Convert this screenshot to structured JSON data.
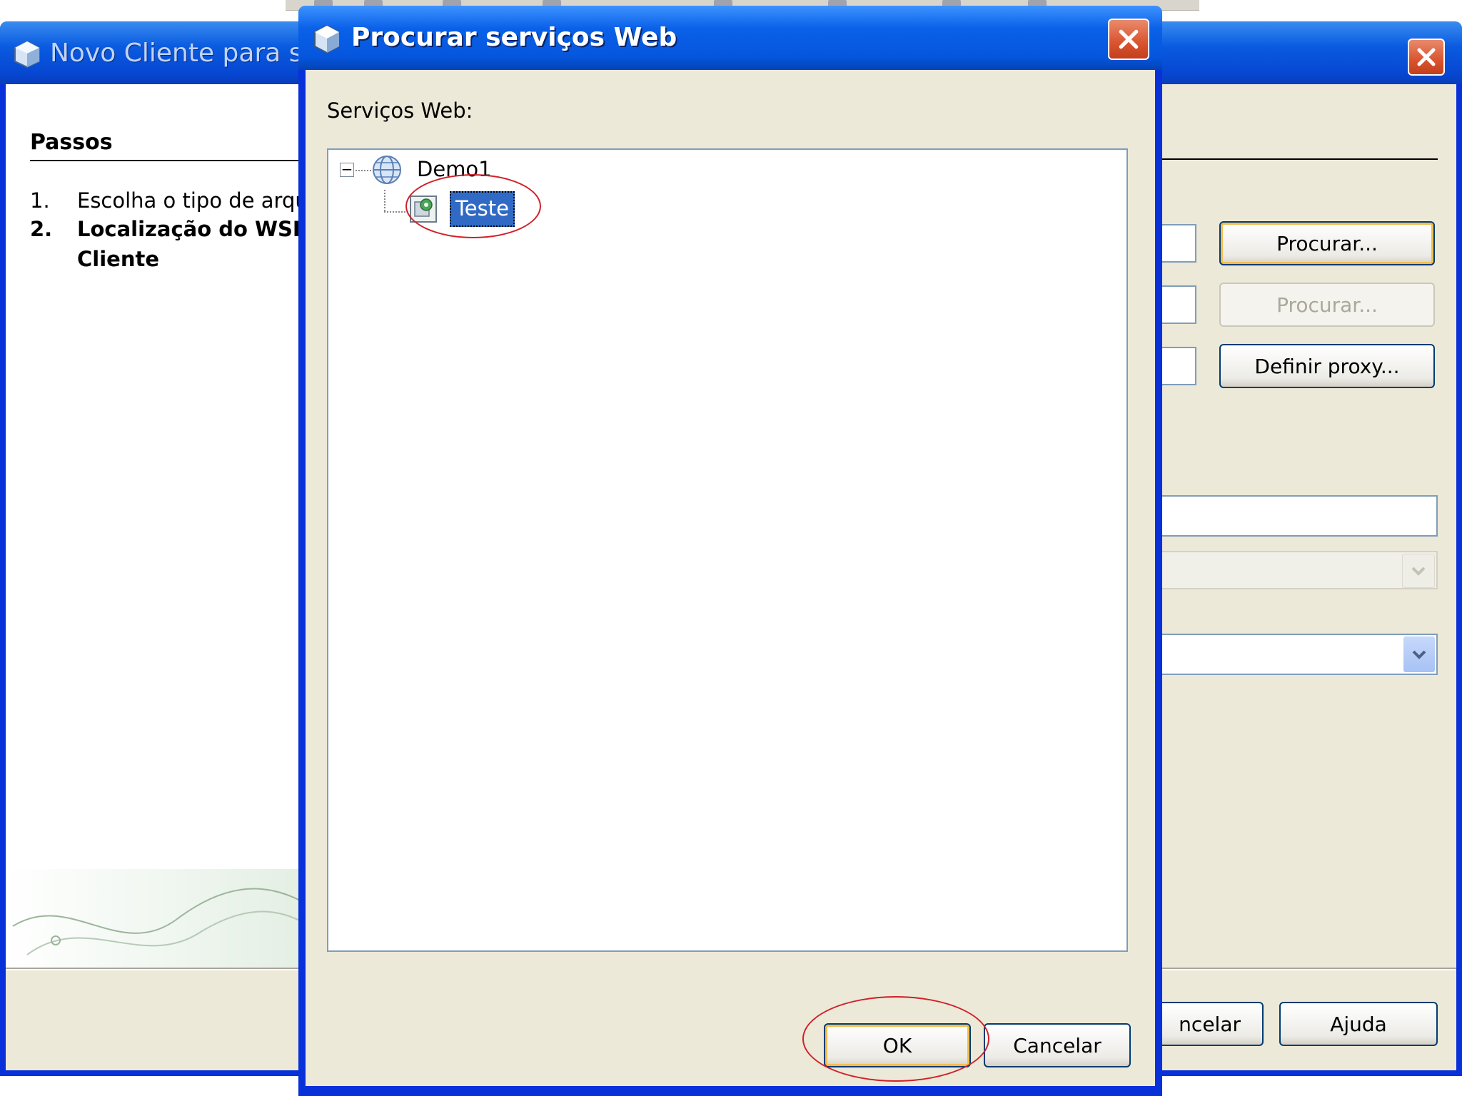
{
  "parent_window": {
    "title": "Novo Cliente para se",
    "steps_heading": "Passos",
    "steps": [
      {
        "num": "1.",
        "label": "Escolha o tipo de arqui"
      },
      {
        "num": "2.",
        "label": "Localização do WSD"
      },
      {
        "num": "",
        "label": "Cliente"
      }
    ],
    "buttons": {
      "procurar_1": "Procurar...",
      "procurar_2": "Procurar...",
      "proxy": "Definir proxy...",
      "cancel_partial": "ncelar",
      "help": "Ajuda"
    }
  },
  "dialog": {
    "title": "Procurar serviços Web",
    "services_label": "Serviços Web:",
    "tree": {
      "root": {
        "label": "Demo1",
        "icon": "globe-icon",
        "expanded": true
      },
      "children": [
        {
          "label": "Teste",
          "icon": "web-service-icon",
          "selected": true
        }
      ]
    },
    "buttons": {
      "ok": "OK",
      "cancel": "Cancelar"
    }
  },
  "colors": {
    "titlebar": "#0a5be0",
    "selection": "#316ac5",
    "annotation": "#d0202a",
    "dialog_bg": "#ece9d8"
  }
}
